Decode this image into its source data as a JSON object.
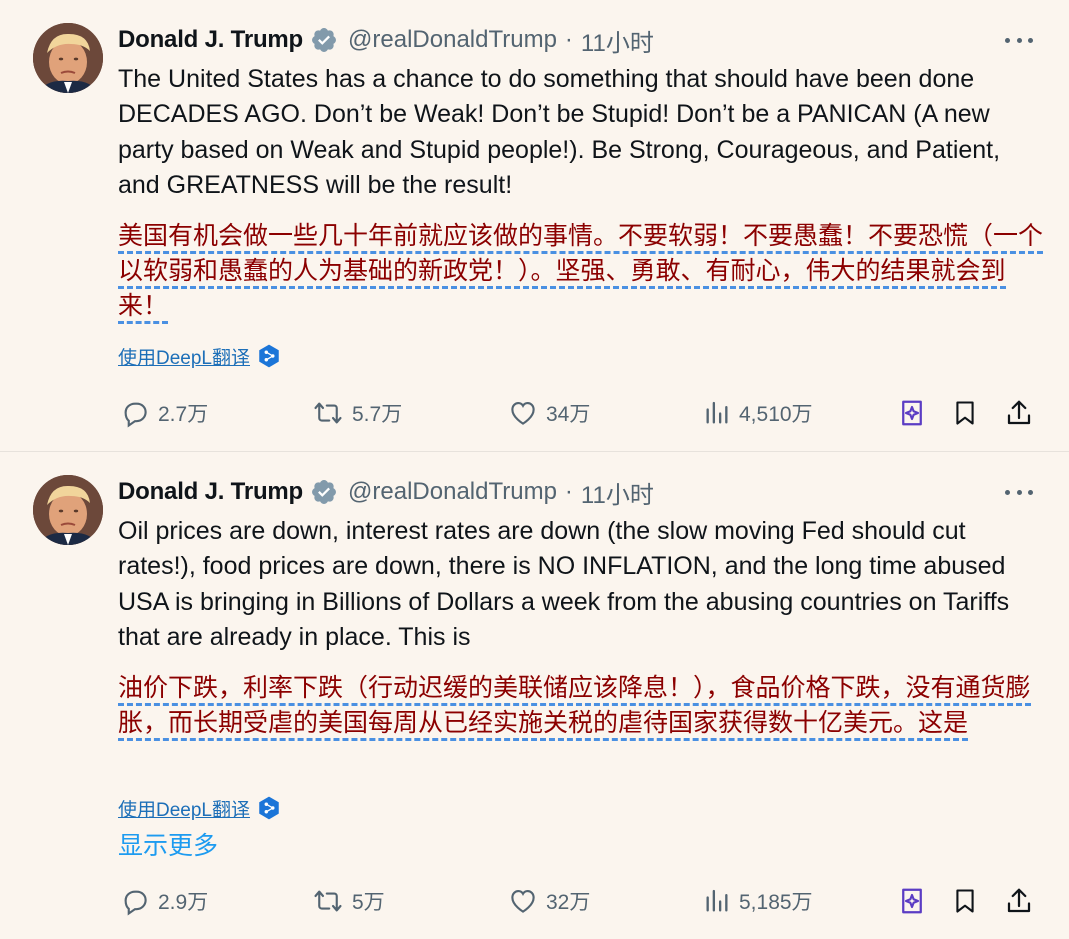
{
  "tweets": [
    {
      "author": {
        "display_name": "Donald J. Trump",
        "handle": "@realDonaldTrump",
        "time": "11小时"
      },
      "text": "The United States has a chance to do something that should have been done DECADES AGO. Don’t be Weak! Don’t be Stupid! Don’t be a PANICAN (A new party based on Weak and Stupid people!). Be Strong, Courageous, and Patient, and GREATNESS will be the result!",
      "translation": "美国有机会做一些几十年前就应该做的事情。不要软弱！不要愚蠢！不要恐慌（一个以软弱和愚蠢的人为基础的新政党！）。坚强、勇敢、有耐心，伟大的结果就会到来！",
      "translate_link": "使用DeepL翻译",
      "show_more": "",
      "stats": {
        "replies": "2.7万",
        "retweets": "5.7万",
        "likes": "34万",
        "views": "4,510万"
      }
    },
    {
      "author": {
        "display_name": "Donald J. Trump",
        "handle": "@realDonaldTrump",
        "time": "11小时"
      },
      "text": "Oil prices are down, interest rates are down (the slow moving Fed should cut rates!), food prices are down, there is NO INFLATION, and the long time abused USA is bringing in Billions of Dollars a week from the abusing countries on Tariffs that are already in place. This is",
      "translation": "油价下跌，利率下跌（行动迟缓的美联储应该降息！），食品价格下跌，没有通货膨胀，而长期受虐的美国每周从已经实施关税的虐待国家获得数十亿美元。这是",
      "translate_link": "使用DeepL翻译",
      "show_more": "显示更多",
      "stats": {
        "replies": "2.9万",
        "retweets": "5万",
        "likes": "32万",
        "views": "5,185万"
      }
    }
  ],
  "colors": {
    "background": "#fbf5ee",
    "text": "#0f1419",
    "muted": "#536471",
    "translation": "#8b0000",
    "link": "#1d6fb8",
    "accent": "#1d9bf0",
    "grok": "#5b3cc4"
  },
  "icons": {
    "verified": "verified-badge-icon",
    "more": "more-icon",
    "deepl": "deepl-logo-icon",
    "reply": "reply-icon",
    "retweet": "retweet-icon",
    "like": "heart-icon",
    "views": "views-chart-icon",
    "grok": "grok-icon",
    "bookmark": "bookmark-icon",
    "share": "share-icon"
  }
}
